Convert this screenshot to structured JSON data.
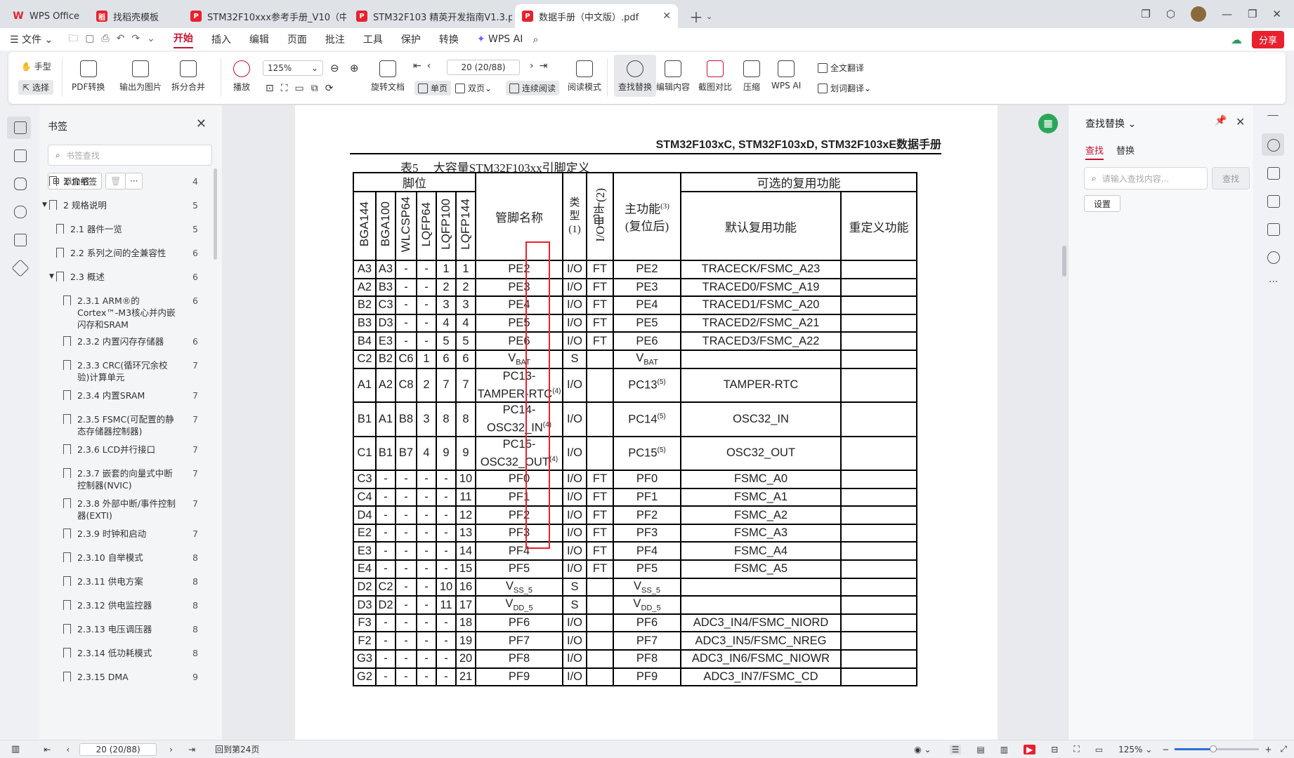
{
  "tabs": [
    {
      "label": "WPS Office",
      "icon": "wps-logo-icon",
      "color": "#e8212e"
    },
    {
      "label": "找稻壳模板",
      "icon": "docer-icon",
      "color": "#e8212e"
    },
    {
      "label": "STM32F10xxx参考手册_V10（中文版",
      "icon": "pdf-icon",
      "color": "#e8212e"
    },
    {
      "label": "STM32F103 精英开发指南V1.3.pdf",
      "icon": "pdf-icon",
      "color": "#e8212e"
    },
    {
      "label": "数据手册（中文版）.pdf",
      "icon": "pdf-icon",
      "color": "#e8212e",
      "active": true
    }
  ],
  "menu": {
    "file": "文件",
    "items": [
      "开始",
      "插入",
      "编辑",
      "页面",
      "批注",
      "工具",
      "保护",
      "转换"
    ],
    "wps_ai": "WPS AI",
    "share": "分享"
  },
  "ribbon": {
    "hand": "手型",
    "select": "选择",
    "pdf_convert": "PDF转换",
    "export_image": "输出为图片",
    "split_merge": "拆分合并",
    "play": "播放",
    "zoom": "125%",
    "rotate": "旋转文档",
    "page_input": "20 (20/88)",
    "single": "单页",
    "double": "双页",
    "continuous": "连续阅读",
    "read_mode": "阅读模式",
    "find_replace": "查找替换",
    "edit_content": "编辑内容",
    "screenshot_compare": "截图对比",
    "compress": "压缩",
    "wps_ai": "WPS AI",
    "full_translate": "全文翻译",
    "word_translate": "划词翻译"
  },
  "bookmarks": {
    "title": "书签",
    "search_placeholder": "书签查找",
    "add": "添加书签",
    "items": [
      {
        "label": "1 介绍",
        "page": "4",
        "level": 0
      },
      {
        "label": "2 规格说明",
        "page": "5",
        "level": 0,
        "expanded": true
      },
      {
        "label": "2.1 器件一览",
        "page": "5",
        "level": 1
      },
      {
        "label": "2.2 系列之间的全兼容性",
        "page": "6",
        "level": 1
      },
      {
        "label": "2.3 概述",
        "page": "6",
        "level": 1,
        "expanded": true
      },
      {
        "label": "2.3.1 ARM®的Cortex™-M3核心并内嵌闪存和SRAM",
        "page": "6",
        "level": 2
      },
      {
        "label": "2.3.2 内置闪存存储器",
        "page": "6",
        "level": 2
      },
      {
        "label": "2.3.3 CRC(循环冗余校验)计算单元",
        "page": "7",
        "level": 2
      },
      {
        "label": "2.3.4 内置SRAM",
        "page": "7",
        "level": 2
      },
      {
        "label": "2.3.5 FSMC(可配置的静态存储器控制器)",
        "page": "7",
        "level": 2
      },
      {
        "label": "2.3.6 LCD并行接口",
        "page": "7",
        "level": 2
      },
      {
        "label": "2.3.7 嵌套的向量式中断控制器(NVIC)",
        "page": "7",
        "level": 2
      },
      {
        "label": "2.3.8 外部中断/事件控制器(EXTI)",
        "page": "7",
        "level": 2
      },
      {
        "label": "2.3.9 时钟和启动",
        "page": "7",
        "level": 2
      },
      {
        "label": "2.3.10 自举模式",
        "page": "8",
        "level": 2
      },
      {
        "label": "2.3.11 供电方案",
        "page": "8",
        "level": 2
      },
      {
        "label": "2.3.12 供电监控器",
        "page": "8",
        "level": 2
      },
      {
        "label": "2.3.13 电压调压器",
        "page": "8",
        "level": 2
      },
      {
        "label": "2.3.14 低功耗模式",
        "page": "8",
        "level": 2
      },
      {
        "label": "2.3.15 DMA",
        "page": "9",
        "level": 2
      }
    ]
  },
  "document": {
    "header": "STM32F103xC, STM32F103xD, STM32F103xE数据手册",
    "caption": "表5　 大容量STM32F103xx引脚定义",
    "col_groups": {
      "pins": "脚位",
      "alt": "可选的复用功能"
    },
    "col_packages": [
      "BGA144",
      "BGA100",
      "WLCSP64",
      "LQFP64",
      "LQFP100",
      "LQFP144"
    ],
    "col_name": "管脚名称",
    "col_type": "类型(1)",
    "col_io": "I/O电平(2)",
    "col_main": "主功能(3)(复位后)",
    "col_default": "默认复用功能",
    "col_remap": "重定义功能",
    "rows": [
      [
        "A3",
        "A3",
        "-",
        "-",
        "1",
        "1",
        "PE2",
        "I/O",
        "FT",
        "PE2",
        "TRACECK/FSMC_A23",
        ""
      ],
      [
        "A2",
        "B3",
        "-",
        "-",
        "2",
        "2",
        "PE3",
        "I/O",
        "FT",
        "PE3",
        "TRACED0/FSMC_A19",
        ""
      ],
      [
        "B2",
        "C3",
        "-",
        "-",
        "3",
        "3",
        "PE4",
        "I/O",
        "FT",
        "PE4",
        "TRACED1/FSMC_A20",
        ""
      ],
      [
        "B3",
        "D3",
        "-",
        "-",
        "4",
        "4",
        "PE5",
        "I/O",
        "FT",
        "PE5",
        "TRACED2/FSMC_A21",
        ""
      ],
      [
        "B4",
        "E3",
        "-",
        "-",
        "5",
        "5",
        "PE6",
        "I/O",
        "FT",
        "PE6",
        "TRACED3/FSMC_A22",
        ""
      ],
      [
        "C2",
        "B2",
        "C6",
        "1",
        "6",
        "6",
        "VBAT",
        "S",
        "",
        "VBAT",
        "",
        ""
      ],
      [
        "A1",
        "A2",
        "C8",
        "2",
        "7",
        "7",
        "PC13-TAMPER-RTC(4)",
        "I/O",
        "",
        "PC13(5)",
        "TAMPER-RTC",
        ""
      ],
      [
        "B1",
        "A1",
        "B8",
        "3",
        "8",
        "8",
        "PC14-OSC32_IN(4)",
        "I/O",
        "",
        "PC14(5)",
        "OSC32_IN",
        ""
      ],
      [
        "C1",
        "B1",
        "B7",
        "4",
        "9",
        "9",
        "PC15-OSC32_OUT(4)",
        "I/O",
        "",
        "PC15(5)",
        "OSC32_OUT",
        ""
      ],
      [
        "C3",
        "-",
        "-",
        "-",
        "-",
        "10",
        "PF0",
        "I/O",
        "FT",
        "PF0",
        "FSMC_A0",
        ""
      ],
      [
        "C4",
        "-",
        "-",
        "-",
        "-",
        "11",
        "PF1",
        "I/O",
        "FT",
        "PF1",
        "FSMC_A1",
        ""
      ],
      [
        "D4",
        "-",
        "-",
        "-",
        "-",
        "12",
        "PF2",
        "I/O",
        "FT",
        "PF2",
        "FSMC_A2",
        ""
      ],
      [
        "E2",
        "-",
        "-",
        "-",
        "-",
        "13",
        "PF3",
        "I/O",
        "FT",
        "PF3",
        "FSMC_A3",
        ""
      ],
      [
        "E3",
        "-",
        "-",
        "-",
        "-",
        "14",
        "PF4",
        "I/O",
        "FT",
        "PF4",
        "FSMC_A4",
        ""
      ],
      [
        "E4",
        "-",
        "-",
        "-",
        "-",
        "15",
        "PF5",
        "I/O",
        "FT",
        "PF5",
        "FSMC_A5",
        ""
      ],
      [
        "D2",
        "C2",
        "-",
        "-",
        "10",
        "16",
        "VSS_5",
        "S",
        "",
        "VSS_5",
        "",
        ""
      ],
      [
        "D3",
        "D2",
        "-",
        "-",
        "11",
        "17",
        "VDD_5",
        "S",
        "",
        "VDD_5",
        "",
        ""
      ],
      [
        "F3",
        "-",
        "-",
        "-",
        "-",
        "18",
        "PF6",
        "I/O",
        "",
        "PF6",
        "ADC3_IN4/FSMC_NIORD",
        ""
      ],
      [
        "F2",
        "-",
        "-",
        "-",
        "-",
        "19",
        "PF7",
        "I/O",
        "",
        "PF7",
        "ADC3_IN5/FSMC_NREG",
        ""
      ],
      [
        "G3",
        "-",
        "-",
        "-",
        "-",
        "20",
        "PF8",
        "I/O",
        "",
        "PF8",
        "ADC3_IN6/FSMC_NIOWR",
        ""
      ],
      [
        "G2",
        "-",
        "-",
        "-",
        "-",
        "21",
        "PF9",
        "I/O",
        "",
        "PF9",
        "ADC3_IN7/FSMC_CD",
        ""
      ]
    ]
  },
  "find_panel": {
    "title": "查找替换",
    "tab_find": "查找",
    "tab_replace": "替换",
    "placeholder": "请输入查找内容...",
    "find_button": "查找",
    "settings": "设置"
  },
  "status": {
    "page_input": "20 (20/88)",
    "back_to": "回到第24页",
    "zoom": "125%"
  },
  "colors": {
    "accent": "#c8102e",
    "highlight": "#e8212e"
  }
}
